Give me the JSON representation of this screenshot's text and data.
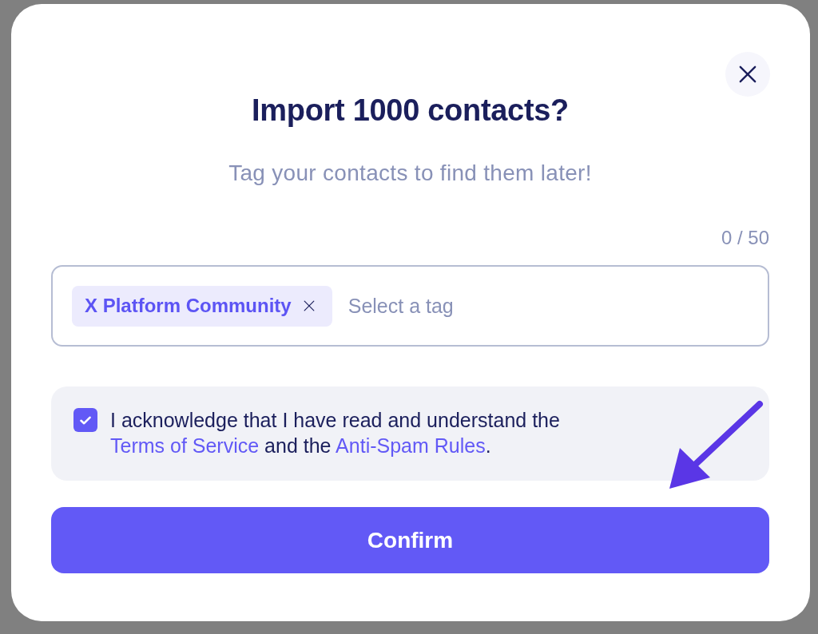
{
  "dialog": {
    "title": "Import 1000 contacts?",
    "subtitle": "Tag your contacts to find them later!",
    "counter": "0 / 50",
    "tag_field": {
      "tags": [
        {
          "label": "X Platform Community"
        }
      ],
      "placeholder": "Select a tag"
    },
    "consent": {
      "checked": true,
      "text": [
        {
          "kind": "text",
          "text": "I acknowledge that I have read and understand the "
        },
        {
          "kind": "link",
          "text": "Terms of Service"
        },
        {
          "kind": "text",
          "text": " and the "
        },
        {
          "kind": "link",
          "text": "Anti-Spam Rules"
        },
        {
          "kind": "text",
          "text": "."
        }
      ]
    },
    "confirm_button": "Confirm"
  }
}
